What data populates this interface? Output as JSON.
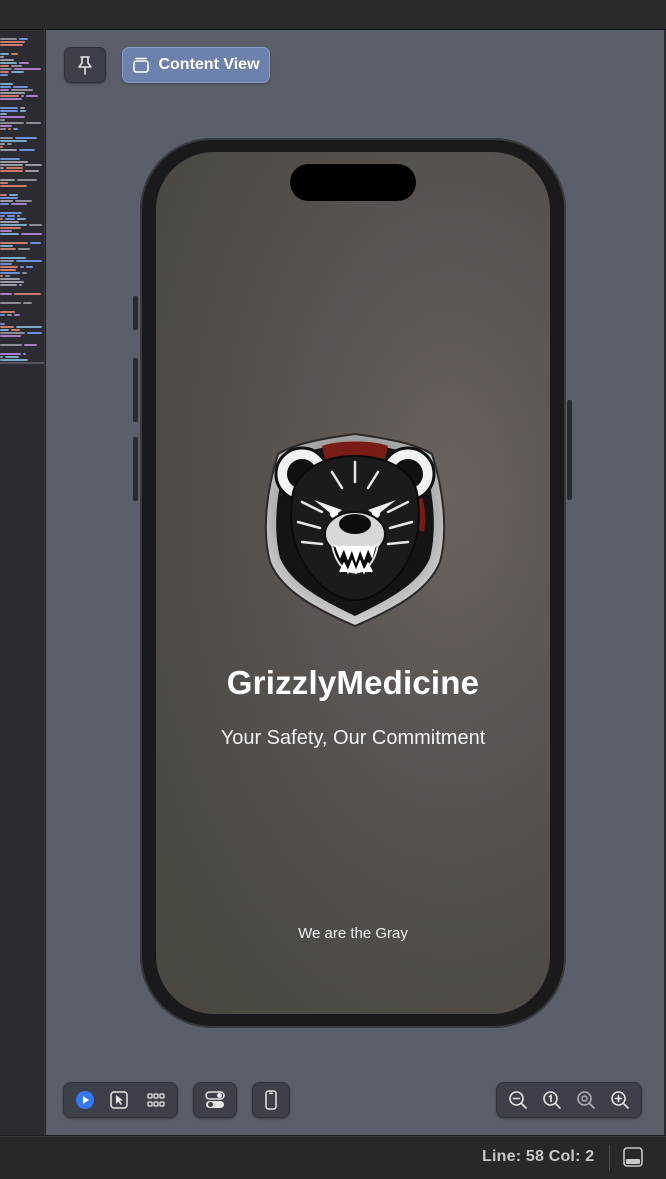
{
  "canvas": {
    "content_view_label": "Content View"
  },
  "app": {
    "title": "GrizzlyMedicine",
    "subtitle": "Your Safety, Our Commitment",
    "footer": "We are the Gray"
  },
  "status": {
    "line_col": "Line: 58  Col: 2"
  },
  "icons": {
    "pin": "pin-icon",
    "content_view": "stacked-window-icon",
    "live": "play-circle-icon",
    "selectable": "cursor-pointer-icon",
    "variants": "grid-icon",
    "settings": "toggles-icon",
    "device": "phone-icon",
    "zoom_out": "zoom-out-icon",
    "zoom_100": "zoom-actual-size-icon",
    "zoom_fit": "zoom-to-fit-icon",
    "zoom_in": "zoom-in-icon",
    "debug_area": "debug-area-icon"
  },
  "colors": {
    "canvas": "#5b5f69",
    "accent": "#3478f6",
    "content_view_button": "#6c82ad"
  }
}
